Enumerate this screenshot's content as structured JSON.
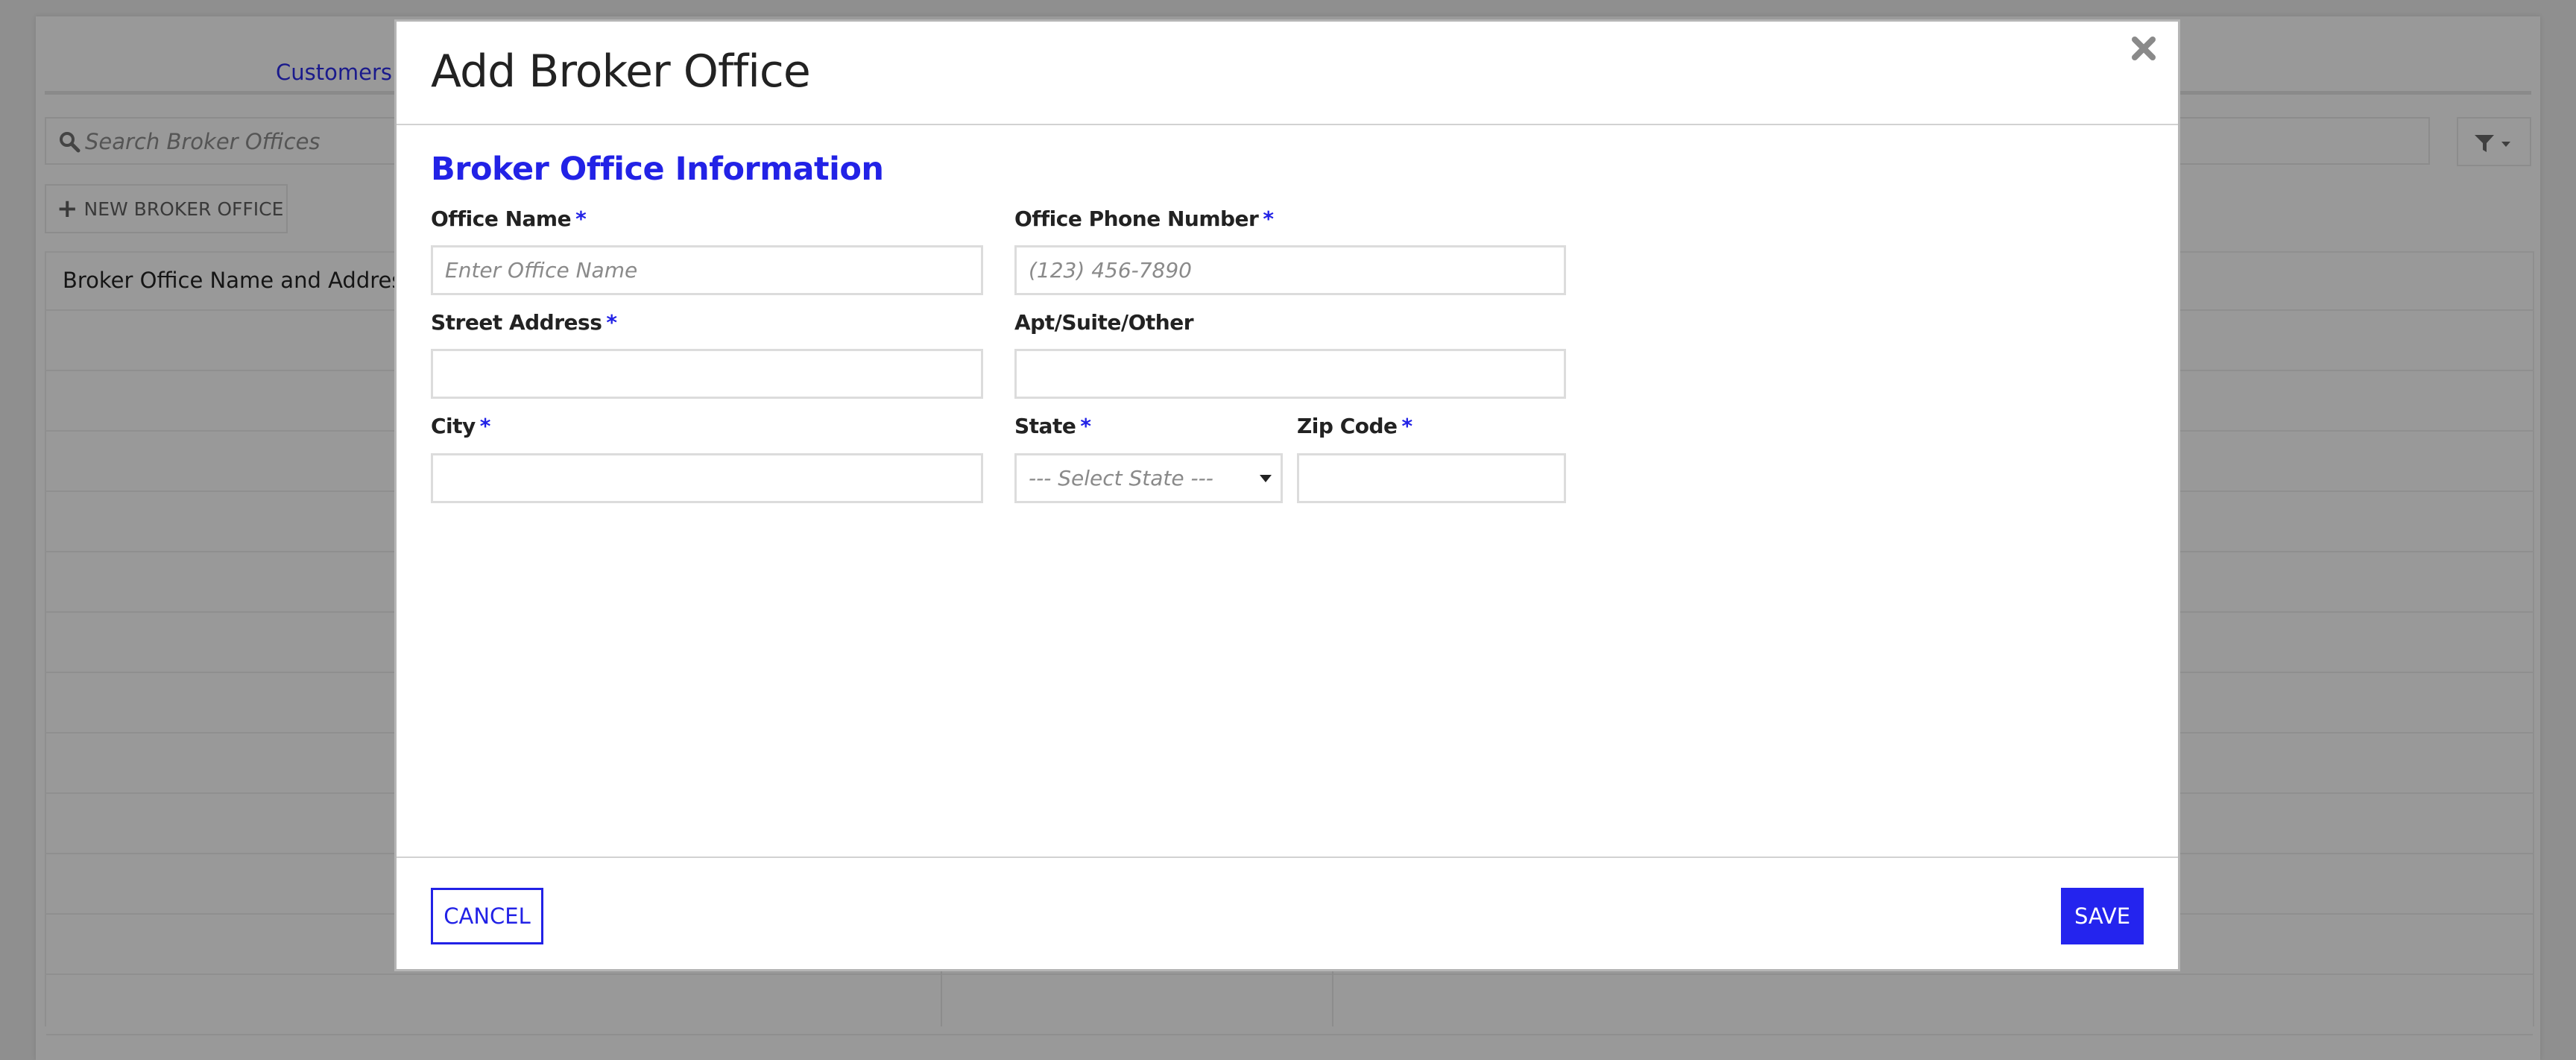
{
  "background": {
    "tabs": [
      {
        "label": "Customers"
      }
    ],
    "search": {
      "placeholder": "Search Broker Offices",
      "icon": "search-icon"
    },
    "new_office_button": {
      "label": "NEW BROKER OFFICE",
      "icon": "plus-icon"
    },
    "filter_button": {
      "icon": "filter-icon",
      "caret": "caret-down-icon"
    },
    "table": {
      "columns": [
        "Broker Office Name and Address",
        "",
        ""
      ],
      "rows": [
        [],
        [],
        [],
        [],
        [],
        [],
        [],
        [],
        [],
        [],
        [],
        []
      ]
    }
  },
  "modal": {
    "title": "Add Broker Office",
    "close_icon": "close-icon",
    "section_title": "Broker Office Information",
    "required_marker": "*",
    "fields": {
      "office_name": {
        "label": "Office Name",
        "required": true,
        "value": "",
        "placeholder": "Enter Office Name"
      },
      "office_phone": {
        "label": "Office Phone Number",
        "required": true,
        "value": "",
        "placeholder": "(123) 456-7890"
      },
      "street_address": {
        "label": "Street Address",
        "required": true,
        "value": "",
        "placeholder": ""
      },
      "apt_suite": {
        "label": "Apt/Suite/Other",
        "required": false,
        "value": "",
        "placeholder": ""
      },
      "city": {
        "label": "City",
        "required": true,
        "value": "",
        "placeholder": ""
      },
      "state": {
        "label": "State",
        "required": true,
        "selected": "--- Select State ---"
      },
      "zip": {
        "label": "Zip Code",
        "required": true,
        "value": "",
        "placeholder": ""
      }
    },
    "footer": {
      "cancel_label": "CANCEL",
      "save_label": "SAVE"
    }
  },
  "colors": {
    "accent": "#2222e6",
    "save_bg": "#2424ee",
    "overlay": "#8f8f8f",
    "label": "#222222",
    "input_border": "#dcdcdc"
  }
}
